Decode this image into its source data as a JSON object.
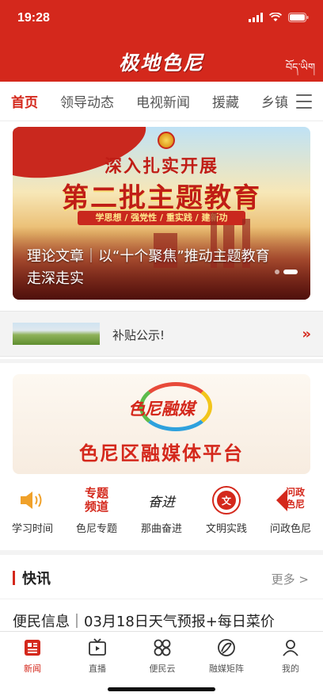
{
  "status_bar": {
    "time": "19:28"
  },
  "header": {
    "logo_text": "极地色尼",
    "tibetan_link": "བོད་ཡིག"
  },
  "tabs": [
    {
      "label": "首页",
      "active": true
    },
    {
      "label": "领导动态",
      "active": false
    },
    {
      "label": "电视新闻",
      "active": false
    },
    {
      "label": "援藏",
      "active": false
    },
    {
      "label": "乡镇",
      "active": false
    }
  ],
  "banner": {
    "line1": "深入扎实开展",
    "line2": "第二批主题教育",
    "slogan": "学思想 / 强党性 / 重实践 / 建新功",
    "caption": "理论文章｜以“十个聚焦”推动主题教育走深走实",
    "slide_index": 2,
    "slide_count": 2
  },
  "notice": {
    "text": "补贴公示!",
    "arrow": "»"
  },
  "promo": {
    "logo_text": "色尼融媒",
    "title": "色尼区融媒体平台"
  },
  "quick_links": [
    {
      "label": "学习时间",
      "icon": "speaker-icon",
      "badge": ""
    },
    {
      "label": "色尼专题",
      "icon": "topic-channel-icon",
      "badge": "专题\n频道"
    },
    {
      "label": "那曲奋进",
      "icon": "calligraphy-icon",
      "badge": "奋进"
    },
    {
      "label": "文明实践",
      "icon": "civilization-seal-icon",
      "badge": "文"
    },
    {
      "label": "问政色尼",
      "icon": "ask-government-icon",
      "badge": "问政\n色尼"
    }
  ],
  "news": {
    "section_title": "快讯",
    "more_label": "更多 >",
    "items": [
      {
        "text": "便民信息｜03月18日天气预报+每日菜价"
      }
    ]
  },
  "bottom_tabs": [
    {
      "label": "新闻",
      "icon": "news-icon",
      "active": true
    },
    {
      "label": "直播",
      "icon": "tv-icon",
      "active": false
    },
    {
      "label": "便民云",
      "icon": "clover-icon",
      "active": false
    },
    {
      "label": "融媒矩阵",
      "icon": "matrix-icon",
      "active": false
    },
    {
      "label": "我的",
      "icon": "user-icon",
      "active": false
    }
  ],
  "colors": {
    "brand_red": "#d4281c",
    "page_bg": "#f3f3f3"
  }
}
